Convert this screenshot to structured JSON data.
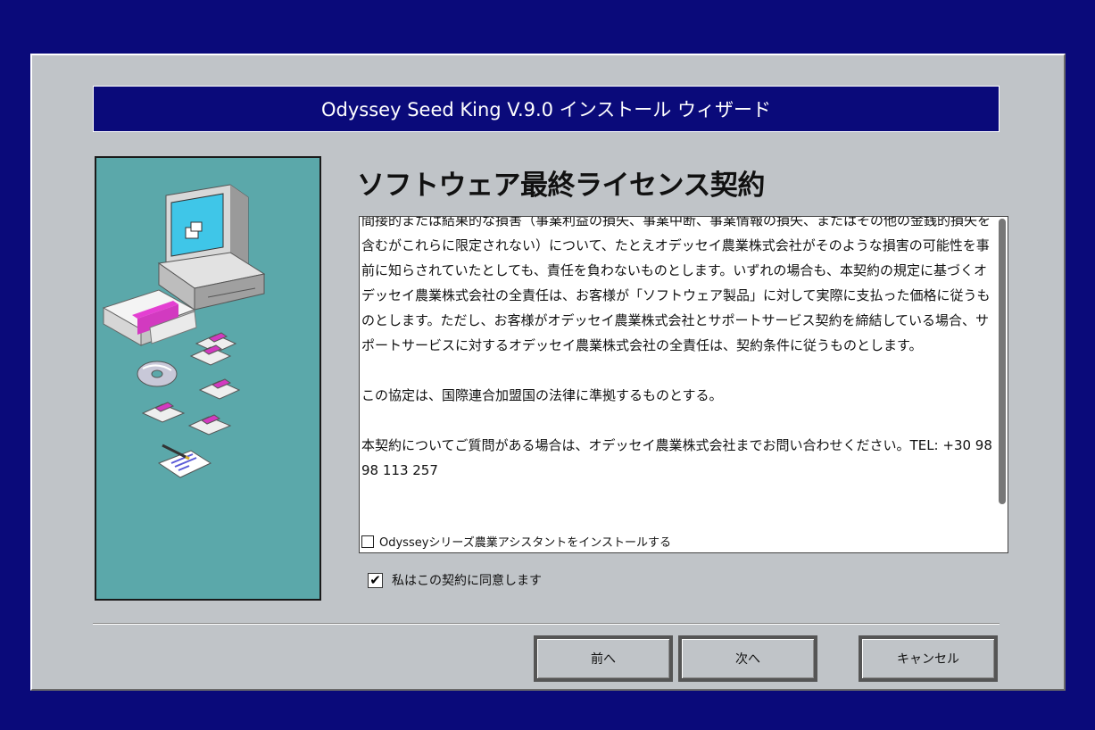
{
  "window": {
    "title": "Odyssey Seed King V.9.0 インストール ウィザード"
  },
  "page": {
    "heading": "ソフトウェア最終ライセンス契約"
  },
  "license": {
    "paragraphs": [
      "間接的または結果的な損害（事業利益の損失、事業中断、事業情報の損失、またはその他の金銭的損失を含むがこれらに限定されない）について、たとえオデッセイ農業株式会社がそのような損害の可能性を事前に知らされていたとしても、責任を負わないものとします。いずれの場合も、本契約の規定に基づくオデッセイ農業株式会社の全責任は、お客様が「ソフトウェア製品」に対して実際に支払った価格に従うものとします。ただし、お客様がオデッセイ農業株式会社とサポートサービス契約を締結している場合、サポートサービスに対するオデッセイ農業株式会社の全責任は、契約条件に従うものとします。",
      "この協定は、国際連合加盟国の法律に準拠するものとする。",
      "本契約についてご質問がある場合は、オデッセイ農業株式会社までお問い合わせください。TEL: +30 9898 113 257"
    ],
    "addon_label": "Odysseyシリーズ農業アシスタントをインストールする",
    "addon_checked": false
  },
  "agree": {
    "label": "私はこの契約に同意します",
    "checked": true,
    "check_mark": "✔"
  },
  "buttons": {
    "back": "前へ",
    "next": "次へ",
    "cancel": "キャンセル"
  },
  "colors": {
    "desktop": "#0a0a7a",
    "window": "#c0c4c8",
    "title_bar": "#0a0a7a",
    "side_panel": "#5ba8aa"
  },
  "icons": {
    "illustration": "computer-setup-illustration"
  }
}
